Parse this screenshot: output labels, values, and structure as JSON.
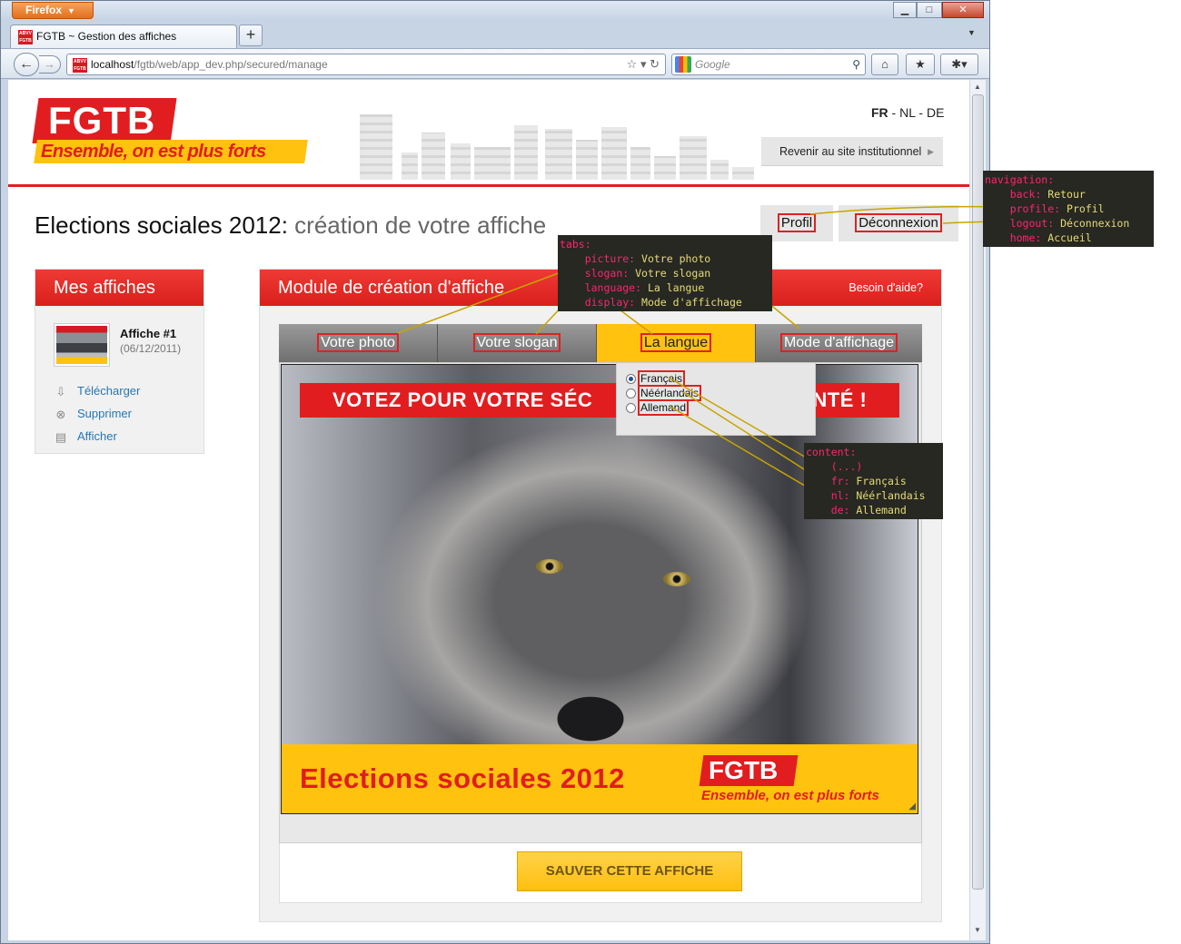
{
  "browser": {
    "app_button": "Firefox",
    "tab_title": "FGTB ~ Gestion des affiches",
    "url_host": "localhost",
    "url_path": "/fgtb/web/app_dev.php/secured/manage",
    "search_placeholder": "Google"
  },
  "header": {
    "logo_text": "FGTB",
    "logo_slogan": "Ensemble, on est plus forts",
    "languages": {
      "fr": "FR",
      "nl": "NL",
      "de": "DE",
      "sep": " - "
    },
    "institutional_button": "Revenir au site institutionnel"
  },
  "title": {
    "main": "Elections sociales 2012",
    "sep": ": ",
    "sub": "création de votre affiche"
  },
  "nav": {
    "profile": "Profil",
    "logout": "Déconnexion"
  },
  "sidebar": {
    "title": "Mes affiches",
    "poster_name": "Affiche #1",
    "poster_date": "(06/12/2011)",
    "links": {
      "download": "Télécharger",
      "delete": "Supprimer",
      "show": "Afficher"
    }
  },
  "module": {
    "title": "Module de création d'affiche",
    "help": "Besoin d'aide?",
    "tabs": {
      "picture": "Votre photo",
      "slogan": "Votre slogan",
      "language": "La langue",
      "display": "Mode d'affichage"
    },
    "language_options": {
      "fr": "Français",
      "nl": "Néérlandais",
      "de": "Allemand"
    },
    "poster": {
      "banner_left": "VOTEZ POUR VOTRE SÉC",
      "banner_right": "ANTÉ !",
      "footer_text": "Elections sociales 2012",
      "logo_text": "FGTB",
      "logo_slogan": "Ensemble, on est plus forts"
    },
    "save_button": "SAUVER CETTE AFFICHE"
  },
  "annotations": {
    "navigation": {
      "root": "navigation:",
      "rows": [
        {
          "key": "back:",
          "value": "Retour"
        },
        {
          "key": "profile:",
          "value": "Profil"
        },
        {
          "key": "logout:",
          "value": "Déconnexion"
        },
        {
          "key": "home:",
          "value": "Accueil"
        }
      ]
    },
    "tabs": {
      "root": "tabs:",
      "rows": [
        {
          "key": "picture:",
          "value": "Votre photo"
        },
        {
          "key": "slogan:",
          "value": "Votre slogan"
        },
        {
          "key": "language:",
          "value": "La langue"
        },
        {
          "key": "display:",
          "value": "Mode d'affichage"
        }
      ]
    },
    "content": {
      "root": "content:",
      "ellipsis": "(...)",
      "rows": [
        {
          "key": "fr:",
          "value": "Français"
        },
        {
          "key": "nl:",
          "value": "Néérlandais"
        },
        {
          "key": "de:",
          "value": "Allemand"
        }
      ]
    }
  },
  "colors": {
    "brand_red": "#e11d20",
    "brand_yellow": "#ffc20e",
    "code_bg": "#272822",
    "code_key": "#f92672",
    "code_value": "#e6db74",
    "leader_line": "#c8a400"
  }
}
